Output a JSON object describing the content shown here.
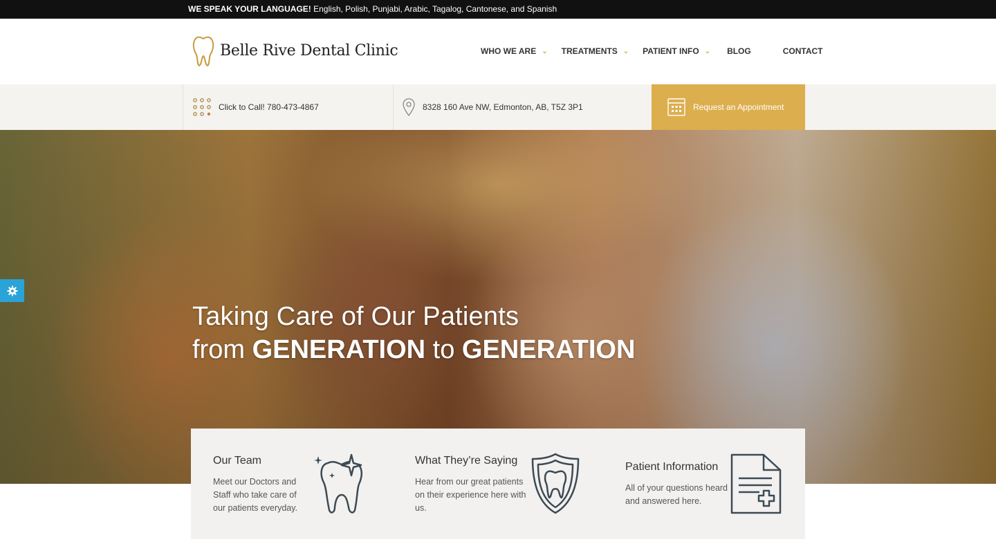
{
  "topbar": {
    "bold": "WE SPEAK YOUR LANGUAGE!",
    "text": " English, Polish, Punjabi, Arabic, Tagalog, Cantonese, and Spanish"
  },
  "header": {
    "logo_text": "Belle Rive Dental Clinic",
    "nav": [
      {
        "label": "WHO WE ARE",
        "has_dropdown": true
      },
      {
        "label": "TREATMENTS",
        "has_dropdown": true
      },
      {
        "label": "PATIENT INFO",
        "has_dropdown": true
      },
      {
        "label": "BLOG",
        "has_dropdown": false
      },
      {
        "label": "CONTACT",
        "has_dropdown": false
      }
    ]
  },
  "infobar": {
    "call": "Click to Call! 780-473-4867",
    "address": "8328 160 Ave NW, Edmonton, AB, T5Z 3P1",
    "appointment": "Request an Appointment"
  },
  "hero": {
    "line1": "Taking Care of Our Patients",
    "line2_a": "from ",
    "line2_b": "GENERATION",
    "line2_c": " to ",
    "line2_d": "GENERATION"
  },
  "features": [
    {
      "title": "Our Team",
      "text": "Meet our Doctors and Staff who take care of our patients everyday.",
      "icon": "sparkling-tooth-icon"
    },
    {
      "title": "What They’re Saying",
      "text": "Hear from our great patients on their experience here with us.",
      "icon": "tooth-shield-icon"
    },
    {
      "title": "Patient Information",
      "text": "All of your questions heard and answered here.",
      "icon": "medical-document-icon"
    }
  ],
  "colors": {
    "accent": "#dcae4e",
    "topbar": "#111111",
    "settings_tab": "#2aa4d6"
  }
}
